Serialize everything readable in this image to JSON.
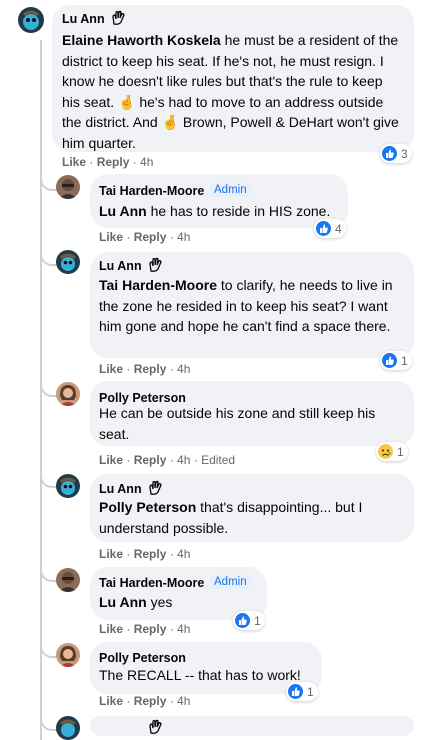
{
  "comments": [
    {
      "author": "Lu Ann",
      "parts": [
        {
          "mention": "Elaine Haworth Koskela",
          "text": " he must be a resident of the district to keep his seat. If he's not, he must resign. I know he doesn't like rules but that's the rule to keep his seat. 🤞 he's had to move to an address outside the district. And 🤞 Brown, Powell & DeHart won't give him quarter."
        }
      ],
      "like": "Like",
      "reply": "Reply",
      "time": "4h",
      "reaction_count": "3"
    },
    {
      "author": "Tai Harden-Moore",
      "badge": "Admin",
      "mention": "Lu Ann",
      "text": " he has to reside in HIS zone.",
      "like": "Like",
      "reply": "Reply",
      "time": "4h",
      "reaction_count": "4"
    },
    {
      "author": "Lu Ann",
      "mention": "Tai Harden-Moore",
      "text": " to clarify, he needs to live in the zone he resided in to keep his seat? I want him gone and hope he can't find a space there.",
      "like": "Like",
      "reply": "Reply",
      "time": "4h",
      "reaction_count": "1"
    },
    {
      "author": "Polly Peterson",
      "text": "He can be outside his zone and still keep his seat.",
      "like": "Like",
      "reply": "Reply",
      "time": "4h",
      "edited": "Edited",
      "reaction_count": "1"
    },
    {
      "author": "Lu Ann",
      "mention": "Polly Peterson",
      "text": " that's disappointing... but I understand possible.",
      "like": "Like",
      "reply": "Reply",
      "time": "4h"
    },
    {
      "author": "Tai Harden-Moore",
      "badge": "Admin",
      "mention": "Lu Ann",
      "text": " yes",
      "like": "Like",
      "reply": "Reply",
      "time": "4h",
      "reaction_count": "1"
    },
    {
      "author": "Polly Peterson",
      "text": "The RECALL -- that has to work!",
      "like": "Like",
      "reply": "Reply",
      "time": "4h",
      "reaction_count": "1"
    }
  ],
  "separator": " · ",
  "colors": {
    "bubble": "#f0f2f5",
    "like_blue": "#1877f2",
    "meta": "#65676b",
    "admin_bg": "#e7f0fd"
  }
}
